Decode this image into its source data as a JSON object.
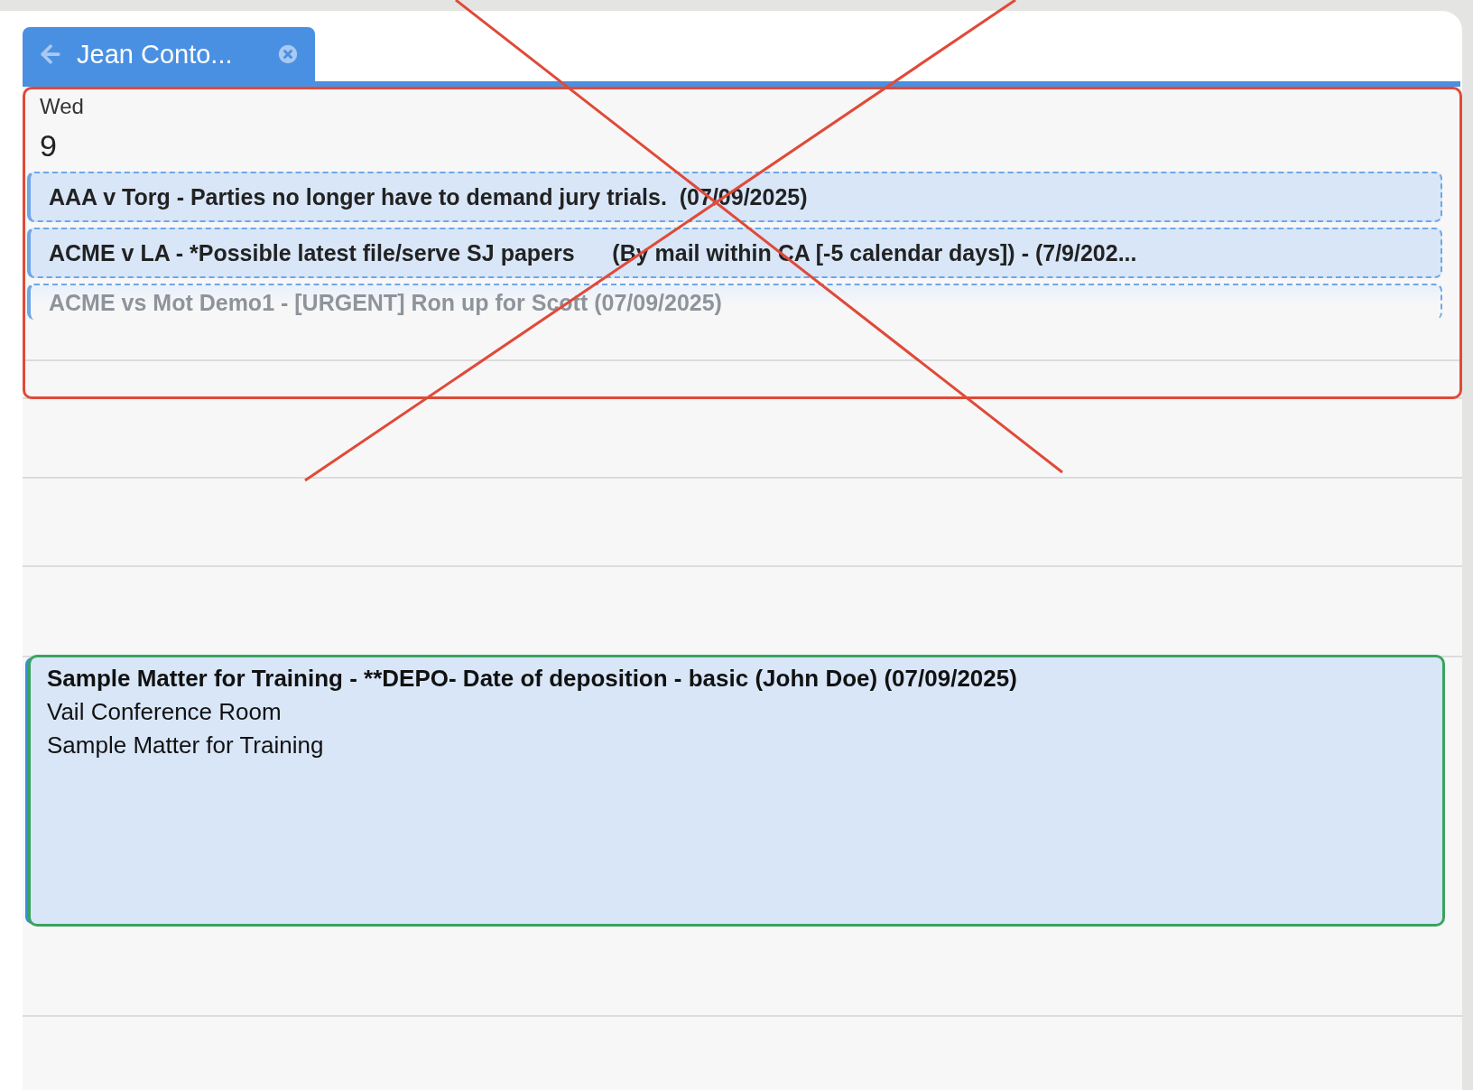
{
  "tab": {
    "title": "Jean Conto...",
    "selected": true
  },
  "day": {
    "weekday": "Wed",
    "date": "9"
  },
  "all_day_events": [
    {
      "title": "AAA v Torg - Parties no longer have to demand jury trials.  (07/09/2025)",
      "faded": false
    },
    {
      "title": "ACME v LA - *Possible latest file/serve SJ papers      (By mail within CA [-5 calendar days]) - (7/9/202...",
      "faded": false
    },
    {
      "title": "ACME vs Mot Demo1 - [URGENT] Ron up for Scott (07/09/2025)",
      "faded": true
    }
  ],
  "timed_event": {
    "title": "Sample Matter for Training - **DEPO- Date of deposition - basic (John Doe) (07/09/2025)",
    "location": "Vail Conference Room",
    "matter": "Sample Matter for Training"
  },
  "annotations": [
    {
      "kind": "section_frame",
      "color": "#e04a38"
    },
    {
      "kind": "cross",
      "color": "#e04a38"
    },
    {
      "kind": "event_frame",
      "color": "#3aa35f"
    }
  ]
}
